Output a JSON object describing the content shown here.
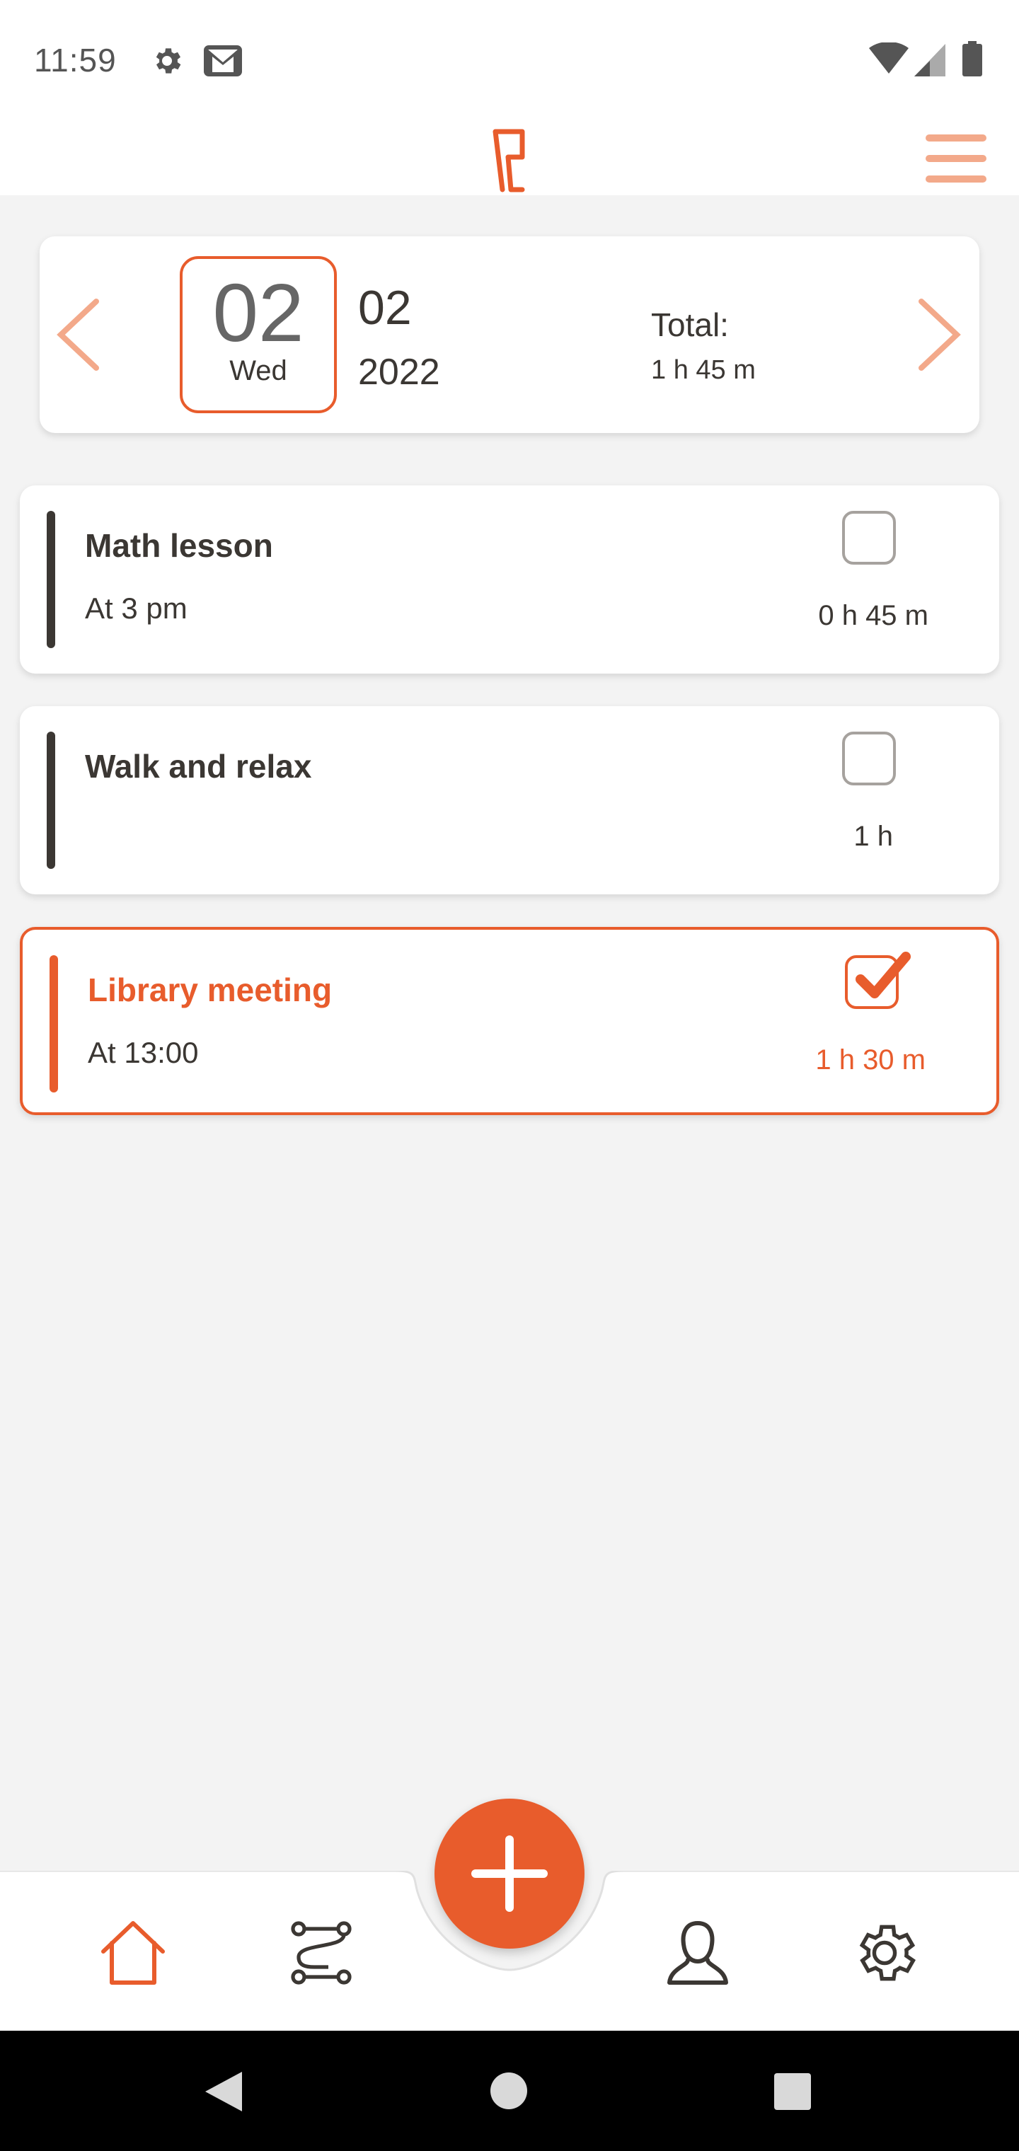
{
  "status_bar": {
    "time": "11:59",
    "icons": [
      "gear-icon",
      "gmail-icon",
      "wifi-icon",
      "signal-icon",
      "battery-icon"
    ]
  },
  "header": {
    "logo_icon": "app-logo-icon",
    "menu_icon": "hamburger-menu-icon"
  },
  "colors": {
    "accent": "#e85c2c",
    "accent_light": "#f3a98a",
    "text": "#3b3733",
    "background": "#f3f3f3"
  },
  "date_card": {
    "day": "02",
    "weekday": "Wed",
    "month": "02",
    "year": "2022",
    "total_label": "Total:",
    "total_value": "1 h 45 m",
    "prev_icon": "chevron-left-icon",
    "next_icon": "chevron-right-icon"
  },
  "tasks": [
    {
      "title": "Math lesson",
      "time": "At 3 pm",
      "duration": "0 h 45 m",
      "done": false
    },
    {
      "title": "Walk and relax",
      "time": "",
      "duration": "1 h",
      "done": false
    },
    {
      "title": "Library meeting",
      "time": "At 13:00",
      "duration": "1 h 30 m",
      "done": true
    }
  ],
  "bottom_nav": {
    "items": [
      "home-icon",
      "flow-icon",
      "profile-icon",
      "settings-icon"
    ],
    "fab_icon": "plus-icon"
  },
  "system_nav": [
    "back-icon",
    "home-circle-icon",
    "recents-icon"
  ]
}
